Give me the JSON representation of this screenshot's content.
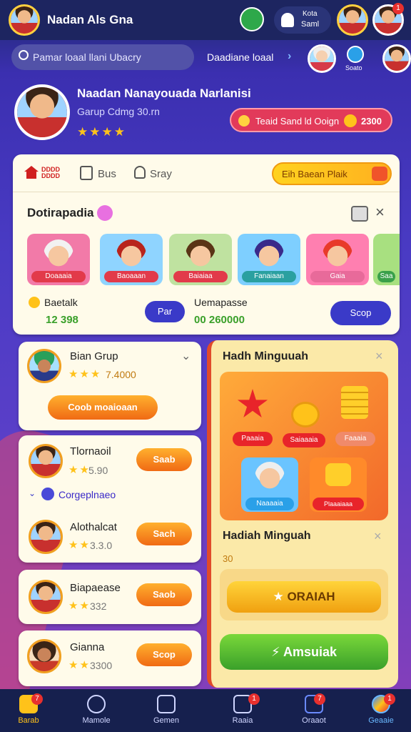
{
  "header": {
    "title": "Nadan Als Gna",
    "right_label_top": "Kota",
    "right_label_bottom": "Saml"
  },
  "search": {
    "placeholder": "Pamar loaal llani Ubacry",
    "link": "Daadiane loaal"
  },
  "search_right_small": "Soato",
  "profile": {
    "name": "Naadan Nanayouada Narlanisi",
    "subtitle": "Garup Cdmg 30.rn",
    "stars": "★★★★",
    "cta_label": "Teaid Sand ld Ooign",
    "cta_value": "2300"
  },
  "tabs": {
    "home": "DDDD DDDD",
    "tab2": "Bus",
    "tab3": "Sray",
    "promo": "Eih Baean Plaik"
  },
  "section": {
    "title": "Dotirapadia"
  },
  "thumbs": [
    {
      "label": "Doaaaia"
    },
    {
      "label": "Baoaaan"
    },
    {
      "label": "Baiaiaa"
    },
    {
      "label": "Fanaiaan"
    },
    {
      "label": "Gaia"
    },
    {
      "label": "Saa"
    }
  ],
  "stats": {
    "left_label": "Baetalk",
    "left_value": "12 398",
    "btn1": "Par",
    "mid_label": "Uemapasse",
    "mid_value": "00 260000",
    "btn2": "Scop"
  },
  "players": [
    {
      "name": "Bian Grup",
      "stars": "★★★",
      "score": "7.4000",
      "btn": "Coob moaioaan"
    },
    {
      "name": "Tlornaoil",
      "stars": "★★",
      "score": "5.90",
      "btn": "Saab"
    },
    {
      "name": "Alothalcat",
      "stars": "★★",
      "score": "3.3.0",
      "btn": "Sach"
    },
    {
      "name": "Biapaease",
      "stars": "★★",
      "score": "332",
      "btn": "Saob"
    },
    {
      "name": "Gianna",
      "stars": "★★",
      "score": "3300",
      "btn": "Scop"
    }
  ],
  "group_label": "Corgeplnaeo",
  "reward": {
    "title": "Hadh Minguuah",
    "items": [
      "Paaaia",
      "Saiaaaia",
      "Faaaia",
      "Naaaaia",
      "Plaaaiaaa"
    ],
    "title2": "Hadiah Minguah",
    "small": "30",
    "btn1": "ORAIAH",
    "btn2": "Amsuiak"
  },
  "nav": [
    "Barab",
    "Mamole",
    "Gemen",
    "Raaia",
    "Oraaot",
    "Geaaie"
  ],
  "colors": {
    "accent": "#f06a14",
    "primary": "#3b2fb0",
    "success": "#4caf20"
  }
}
